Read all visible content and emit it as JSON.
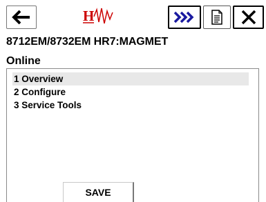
{
  "toolbar": {
    "back_icon": "left-arrow-icon",
    "logo": {
      "brand_letter": "H",
      "icon": "hart-waveform-icon",
      "color": "#cc0000"
    },
    "forward_icon": "double-chevron-right-icon",
    "forward_color": "#1a1aa0",
    "doc_icon": "document-icon",
    "close_icon": "close-x-icon"
  },
  "device": {
    "title": "8712EM/8732EM HR7:MAGMET",
    "status": "Online"
  },
  "menu": {
    "items": [
      {
        "label": "1 Overview",
        "selected": true
      },
      {
        "label": "2 Configure",
        "selected": false
      },
      {
        "label": "3 Service Tools",
        "selected": false
      }
    ]
  },
  "footer": {
    "save_label": "SAVE"
  }
}
